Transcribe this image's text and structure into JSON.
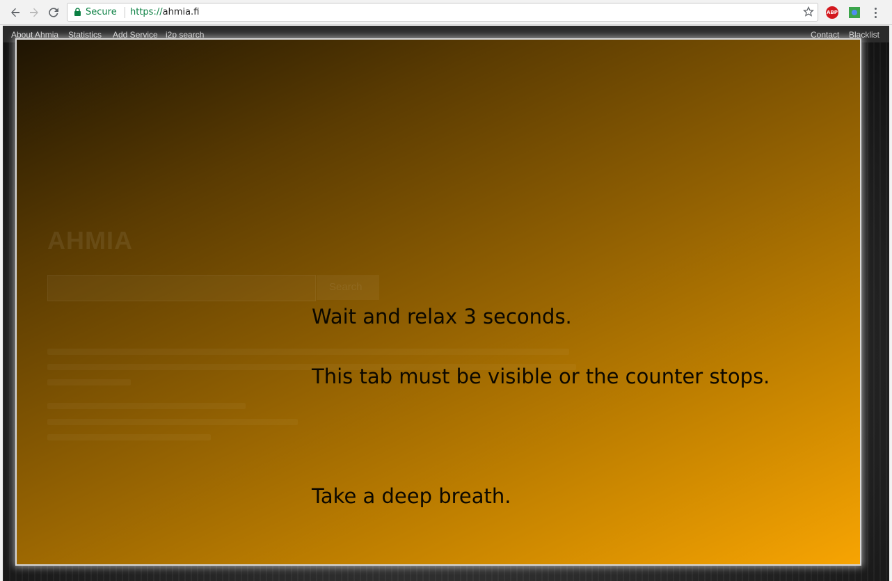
{
  "browser": {
    "secure_label": "Secure",
    "url_scheme": "https://",
    "url_host": "ahmia.fi",
    "icons": [
      "back-arrow-icon",
      "forward-arrow-icon",
      "reload-icon",
      "lock-icon",
      "star-icon",
      "adblock-plus-icon",
      "extension-icon",
      "menu-icon"
    ],
    "abp_label": "ABP"
  },
  "site_nav": {
    "left_links": [
      "About Ahmia",
      "Statistics",
      "Add Service",
      "i2p search"
    ],
    "right_links": [
      "Contact",
      "Blacklist"
    ]
  },
  "overlay": {
    "line1": "Wait and relax 3 seconds.",
    "line2": "This tab must be visible or the counter stops.",
    "line3": "Take a deep breath.",
    "gradient_colors": [
      "#1e1403",
      "#5a3b02",
      "#8e5e02",
      "#c98600",
      "#f7a402"
    ]
  },
  "background_page": {
    "logo": "AHMIA",
    "search_button": "Search"
  }
}
